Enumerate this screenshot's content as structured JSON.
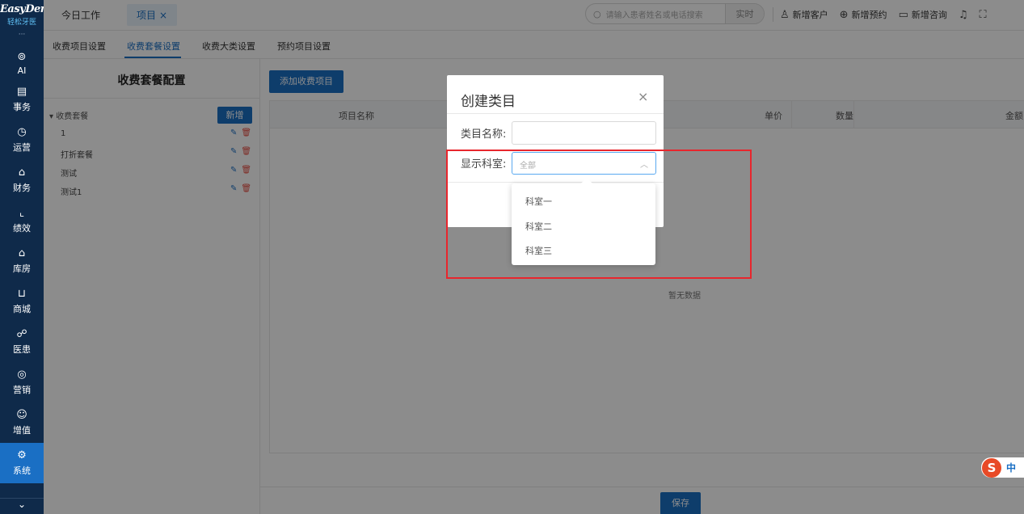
{
  "brand": {
    "logo_text": "EasyDent",
    "logo_sub": "轻松牙医"
  },
  "sidebar": {
    "items": [
      {
        "label": "AI",
        "icon": "ai-icon"
      },
      {
        "label": "事务",
        "icon": "clipboard-icon"
      },
      {
        "label": "运营",
        "icon": "clock-icon"
      },
      {
        "label": "财务",
        "icon": "wallet-icon"
      },
      {
        "label": "绩效",
        "icon": "chart-icon"
      },
      {
        "label": "库房",
        "icon": "warehouse-icon"
      },
      {
        "label": "商城",
        "icon": "cart-icon"
      },
      {
        "label": "医患",
        "icon": "people-icon"
      },
      {
        "label": "营销",
        "icon": "target-icon"
      },
      {
        "label": "增值",
        "icon": "face-icon"
      },
      {
        "label": "系统",
        "icon": "gear-icon"
      }
    ],
    "active": "系统"
  },
  "topbar": {
    "tab_today": "今日工作",
    "tab_project": "项目",
    "tab_close": "×",
    "search_placeholder": "请输入患者姓名或电话搜索",
    "search_mode": "实时",
    "actions": [
      "新增客户",
      "新增预约",
      "新增咨询"
    ]
  },
  "subtabs": [
    "收费项目设置",
    "收费套餐设置",
    "收费大类设置",
    "预约项目设置"
  ],
  "left_panel": {
    "title": "收费套餐配置",
    "new_button": "新增",
    "tree_root": "收费套餐",
    "items": [
      "1",
      "打折套餐",
      "测试",
      "测试1"
    ]
  },
  "main": {
    "add_button": "添加收费项目",
    "columns": [
      "项目名称",
      "单价",
      "数量",
      "金额"
    ],
    "empty_text": "暂无数据",
    "save_button": "保存"
  },
  "modal": {
    "title": "创建类目",
    "close": "×",
    "name_label": "类目名称:",
    "name_value": "",
    "dept_label": "显示科室:",
    "dept_value": "全部",
    "dept_options": [
      "科室一",
      "科室二",
      "科室三"
    ]
  },
  "ime": {
    "lang": "中"
  }
}
